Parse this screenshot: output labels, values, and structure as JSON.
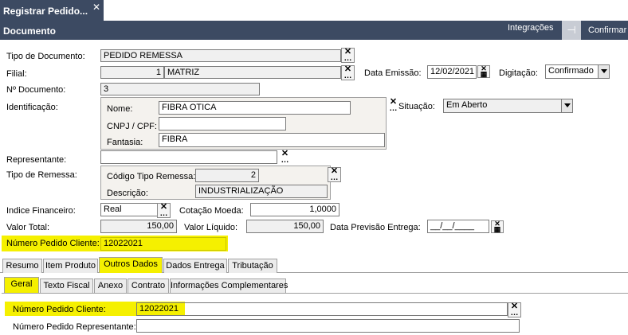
{
  "window": {
    "tab_title": "Registrar Pedido...",
    "close": "✕"
  },
  "header": {
    "title": "Documento",
    "integrations_label": "Integrações",
    "pin_label": "⊣",
    "confirm_label": "Confirmar"
  },
  "form": {
    "tipo_documento": {
      "label": "Tipo de Documento:",
      "value": "PEDIDO REMESSA"
    },
    "filial": {
      "label": "Filial:",
      "code": "1",
      "name": "MATRIZ"
    },
    "data_emissao": {
      "label": "Data Emissão:",
      "value": "12/02/2021"
    },
    "digitacao": {
      "label": "Digitação:",
      "value": "Confirmado"
    },
    "num_documento": {
      "label": "Nº Documento:",
      "value": "3"
    },
    "identificacao": {
      "label": "Identificação:",
      "nome_label": "Nome:",
      "nome": "FIBRA OTICA",
      "cnpj_label": "CNPJ / CPF:",
      "cnpj": "",
      "fantasia_label": "Fantasia:",
      "fantasia": "FIBRA"
    },
    "situacao": {
      "label": "Situação:",
      "value": "Em Aberto"
    },
    "representante": {
      "label": "Representante:",
      "value": ""
    },
    "tipo_remessa": {
      "label": "Tipo de Remessa:",
      "codigo_label": "Código Tipo Remessa:",
      "codigo": "2",
      "descricao_label": "Descrição:",
      "descricao": "INDUSTRIALIZAÇÃO"
    },
    "indice_financeiro": {
      "label": "Indice Financeiro:",
      "value": "Real"
    },
    "cotacao_moeda": {
      "label": "Cotação Moeda:",
      "value": "1,0000"
    },
    "valor_total": {
      "label": "Valor Total:",
      "value": "150,00"
    },
    "valor_liquido": {
      "label": "Valor Líquido:",
      "value": "150,00"
    },
    "data_previsao": {
      "label": "Data Previsão Entrega:",
      "value": "__/__/____"
    },
    "num_pedido_cliente": {
      "label": "Número Pedido Cliente:",
      "value": "12022021"
    }
  },
  "tabs": [
    {
      "label": "Resumo"
    },
    {
      "label": "Item Produto"
    },
    {
      "label": "Outros Dados"
    },
    {
      "label": "Dados Entrega"
    },
    {
      "label": "Tributação"
    }
  ],
  "subtabs": [
    {
      "label": "Geral"
    },
    {
      "label": "Texto Fiscal"
    },
    {
      "label": "Anexo"
    },
    {
      "label": "Contrato"
    },
    {
      "label": "Informações Complementares"
    }
  ],
  "geral": {
    "num_pedido_cliente_label": "Número Pedido Cliente:",
    "num_pedido_cliente": "12022021",
    "num_pedido_representante_label": "Número Pedido Representante:",
    "num_pedido_representante": ""
  },
  "colors": {
    "header_bg": "#3c4a62",
    "highlight": "#f5f000"
  }
}
